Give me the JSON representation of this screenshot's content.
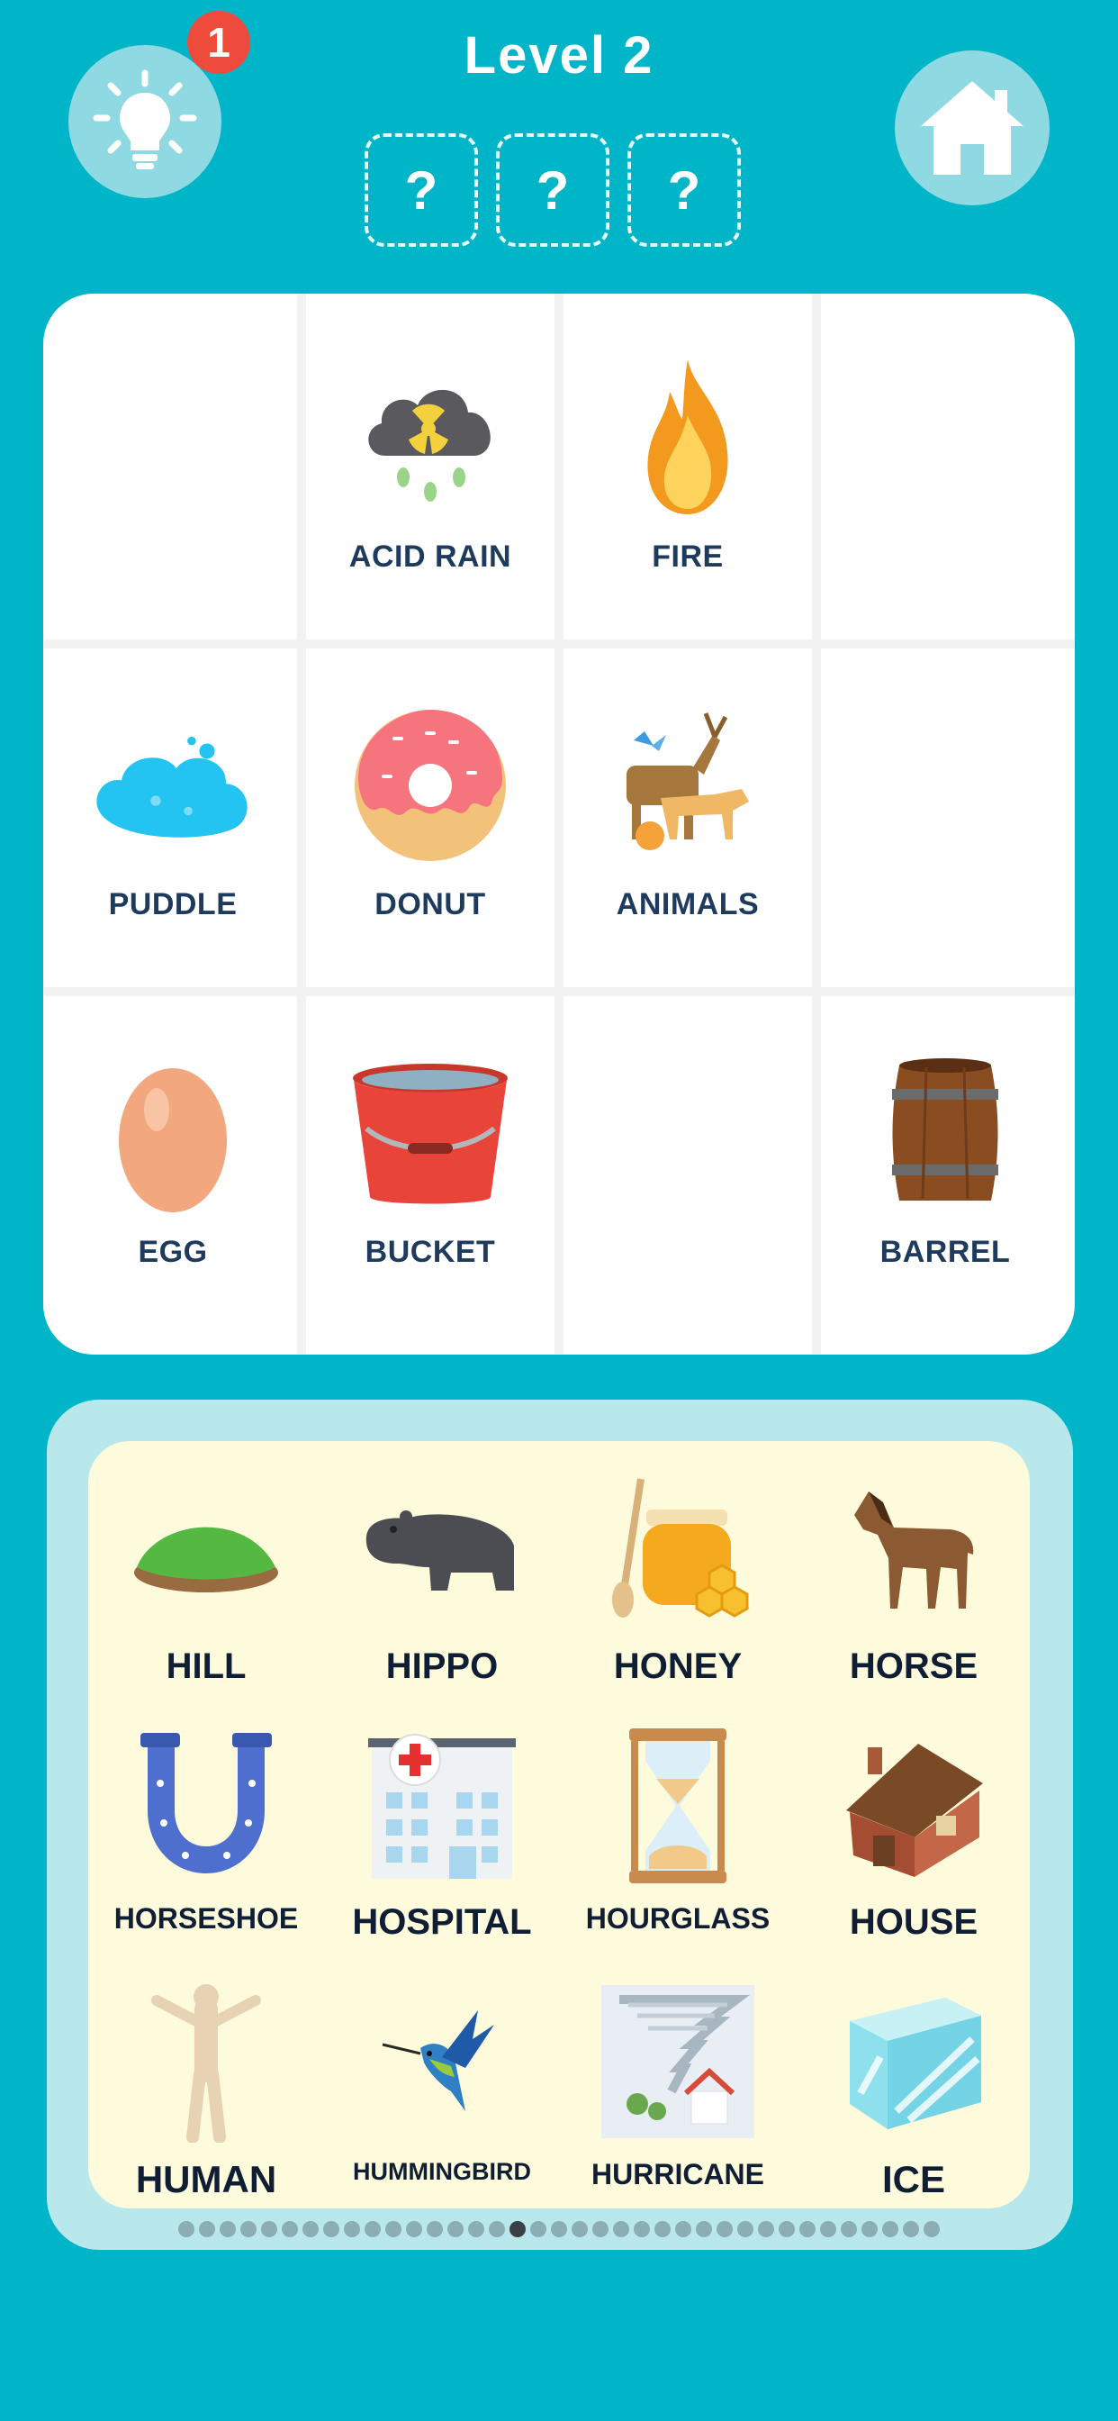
{
  "header": {
    "level_title": "Level 2",
    "hint_badge": "1",
    "slots": [
      "?",
      "?",
      "?"
    ]
  },
  "board": {
    "rows": [
      [
        {
          "label": "",
          "icon": ""
        },
        {
          "label": "ACID RAIN",
          "icon": "acid-rain-icon"
        },
        {
          "label": "FIRE",
          "icon": "fire-icon"
        },
        {
          "label": "",
          "icon": ""
        }
      ],
      [
        {
          "label": "PUDDLE",
          "icon": "puddle-icon"
        },
        {
          "label": "DONUT",
          "icon": "donut-icon"
        },
        {
          "label": "ANIMALS",
          "icon": "animals-icon"
        },
        {
          "label": "",
          "icon": ""
        }
      ],
      [
        {
          "label": "EGG",
          "icon": "egg-icon"
        },
        {
          "label": "BUCKET",
          "icon": "bucket-icon"
        },
        {
          "label": "",
          "icon": ""
        },
        {
          "label": "BARREL",
          "icon": "barrel-icon"
        }
      ]
    ]
  },
  "tray": {
    "items": [
      {
        "label": "HILL",
        "icon": "hill-icon"
      },
      {
        "label": "HIPPO",
        "icon": "hippo-icon"
      },
      {
        "label": "HONEY",
        "icon": "honey-icon"
      },
      {
        "label": "HORSE",
        "icon": "horse-icon"
      },
      {
        "label": "HORSESHOE",
        "icon": "horseshoe-icon"
      },
      {
        "label": "HOSPITAL",
        "icon": "hospital-icon"
      },
      {
        "label": "HOURGLASS",
        "icon": "hourglass-icon"
      },
      {
        "label": "HOUSE",
        "icon": "house-icon"
      },
      {
        "label": "HUMAN",
        "icon": "human-icon"
      },
      {
        "label": "HUMMINGBIRD",
        "icon": "hummingbird-icon"
      },
      {
        "label": "HURRICANE",
        "icon": "hurricane-icon"
      },
      {
        "label": "ICE",
        "icon": "ice-icon"
      }
    ],
    "page_count": 37,
    "active_page": 16
  },
  "colors": {
    "background": "#00b5c7",
    "button_bg": "#8fd9e2",
    "badge": "#ef4b3d",
    "board_label": "#1e3a5c",
    "tray_bg": "#fdfbdb",
    "tray_outer": "#b9e8ec"
  }
}
